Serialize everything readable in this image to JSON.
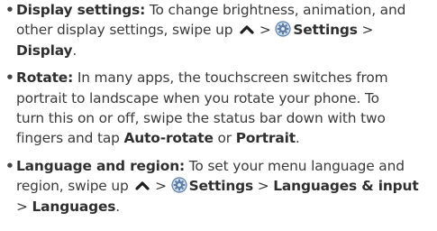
{
  "bullet_glyph": "•",
  "items": [
    {
      "label": "Display settings:",
      "l1_text": " To change brightness, animation, and",
      "l2_a": "other display settings, swipe up ",
      "l2_sep": " > ",
      "l2_settings": "Settings",
      "l2_end": " >",
      "l3_display": "Display",
      "l3_end": "."
    },
    {
      "label": "Rotate:",
      "l1_text": " In many apps, the touchscreen switches from",
      "l2_text": "portrait to landscape when you rotate your phone. To",
      "l3_text": "turn this on or off, swipe the status bar down with two",
      "l4_a": "fingers and tap ",
      "l4_autorotate": "Auto-rotate",
      "l4_or": " or ",
      "l4_portrait": "Portrait",
      "l4_end": "."
    },
    {
      "label": "Language and region:",
      "l1_text": " To set your menu language and",
      "l2_a": "region, swipe up ",
      "l2_sep": " > ",
      "l2_settings": "Settings",
      "l2_gt": " > ",
      "l2_lang_input": "Languages & input",
      "l3_gt": "> ",
      "l3_languages": "Languages",
      "l3_end": "."
    }
  ],
  "icons": {
    "swipe_up": "caret-up-icon",
    "settings": "gear-icon"
  },
  "colors": {
    "text": "#3a3a3a",
    "gear_dark": "#5b7ea6",
    "gear_light": "#b9cde3"
  }
}
